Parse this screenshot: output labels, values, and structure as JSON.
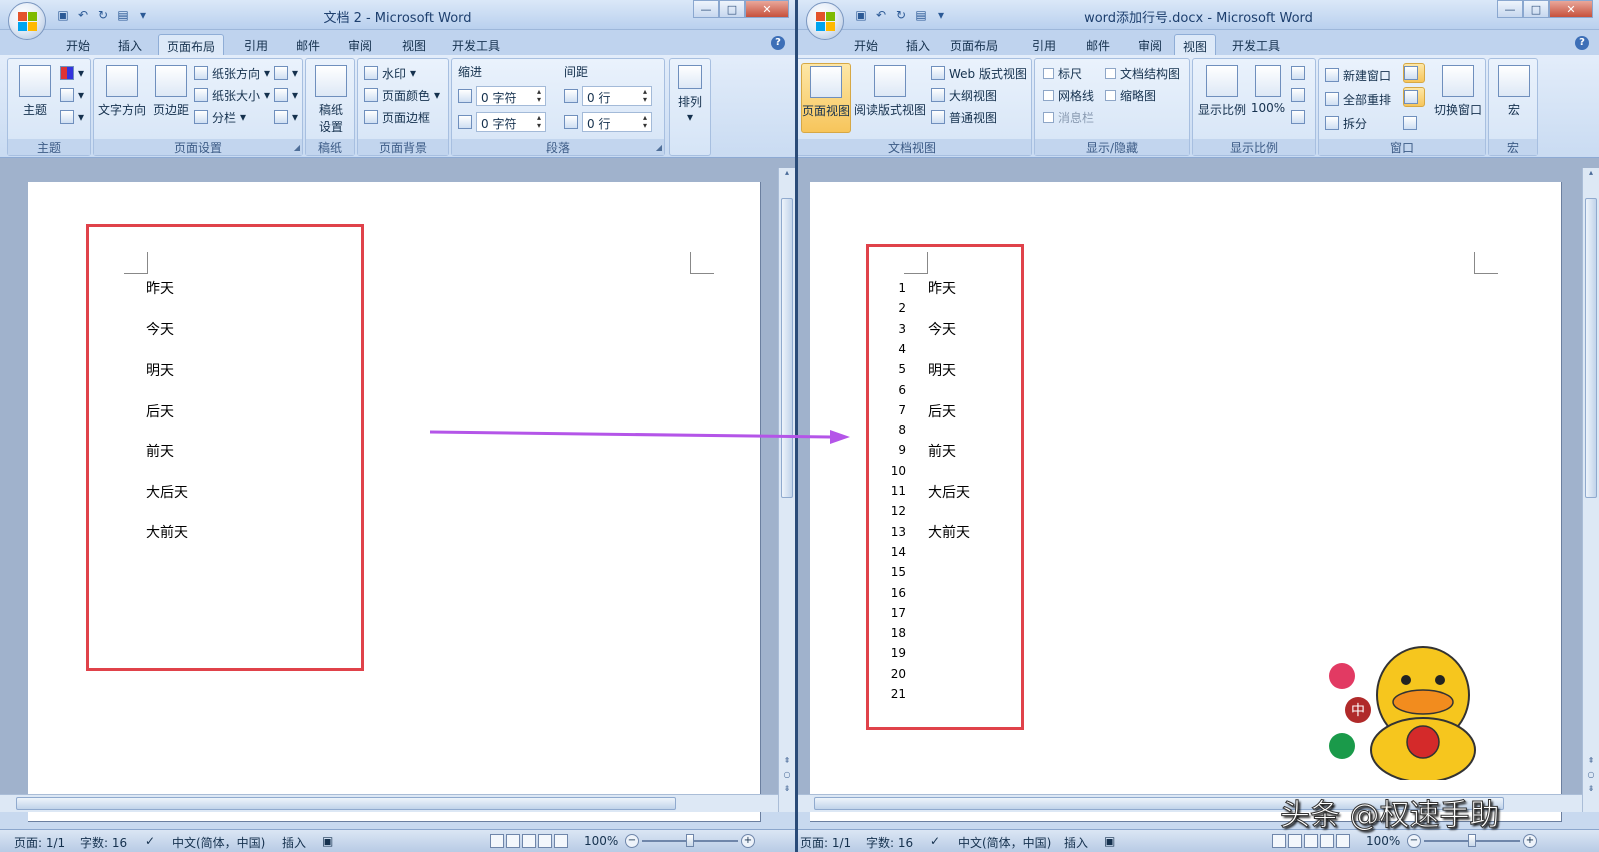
{
  "left_window": {
    "title": "文档 2 - Microsoft Word",
    "tabs": [
      "开始",
      "插入",
      "页面布局",
      "引用",
      "邮件",
      "审阅",
      "视图",
      "开发工具"
    ],
    "active_tab": "页面布局",
    "ribbon": {
      "theme_group": {
        "label": "主题",
        "button": "主题"
      },
      "page_setup_group": {
        "label": "页面设置",
        "text_direction": "文字方向",
        "margins": "页边距",
        "orientation": "纸张方向",
        "size": "纸张大小",
        "columns": "分栏"
      },
      "draft_group": {
        "label": "稿纸",
        "button": "稿纸\n设置",
        "button_line1": "稿纸",
        "button_line2": "设置"
      },
      "page_bg_group": {
        "label": "页面背景",
        "watermark": "水印",
        "page_color": "页面颜色",
        "page_border": "页面边框"
      },
      "paragraph_group": {
        "label": "段落",
        "indent_header": "缩进",
        "spacing_header": "间距",
        "indent_left": "0 字符",
        "indent_right": "0 字符",
        "spacing_before": "0 行",
        "spacing_after": "0 行"
      },
      "arrange_group": {
        "button": "排列"
      }
    },
    "document_lines": [
      "昨天",
      "今天",
      "明天",
      "后天",
      "前天",
      "大后天",
      "大前天"
    ],
    "status": {
      "page": "页面: 1/1",
      "words": "字数: 16",
      "language": "中文(简体，中国)",
      "mode": "插入",
      "zoom": "100%"
    }
  },
  "right_window": {
    "title": "word添加行号.docx - Microsoft Word",
    "tabs": [
      "开始",
      "插入",
      "页面布局",
      "引用",
      "邮件",
      "审阅",
      "视图",
      "开发工具"
    ],
    "active_tab": "视图",
    "ribbon": {
      "doc_views_group": {
        "label": "文档视图",
        "print_layout": "页面视图",
        "full_reading": "阅读版式视图",
        "web_layout": "Web 版式视图",
        "outline": "大纲视图",
        "draft": "普通视图"
      },
      "show_hide_group": {
        "label": "显示/隐藏",
        "ruler": "标尺",
        "gridlines": "网格线",
        "message_bar": "消息栏",
        "doc_map": "文档结构图",
        "thumbnails": "缩略图"
      },
      "zoom_group": {
        "label": "显示比例",
        "zoom": "显示比例",
        "hundred": "100%"
      },
      "window_group": {
        "label": "窗口",
        "new_window": "新建窗口",
        "arrange_all": "全部重排",
        "split": "拆分",
        "switch_windows": "切换窗口"
      },
      "macros_group": {
        "label": "宏",
        "button": "宏"
      }
    },
    "line_numbers": [
      "1",
      "2",
      "3",
      "4",
      "5",
      "6",
      "7",
      "8",
      "9",
      "10",
      "11",
      "12",
      "13",
      "14",
      "15",
      "16",
      "17",
      "18",
      "19",
      "20",
      "21"
    ],
    "document_lines": [
      "昨天",
      "今天",
      "明天",
      "后天",
      "前天",
      "大后天",
      "大前天"
    ],
    "status": {
      "page": "页面: 1/1",
      "words": "字数: 16",
      "language": "中文(简体，中国)",
      "mode": "插入",
      "zoom": "100%"
    }
  },
  "overlay": {
    "watermark_text": "头条 @权速手助",
    "arrow_color": "#b455e8",
    "highlight_color": "#e0424a",
    "ime_badge": "中"
  }
}
